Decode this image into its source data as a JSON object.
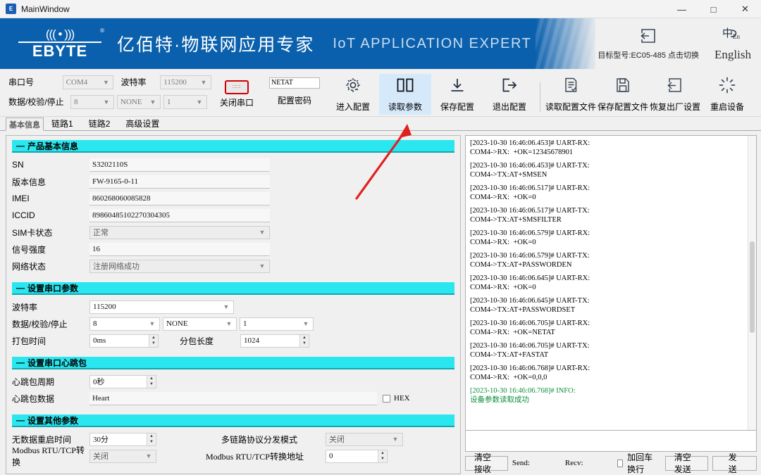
{
  "window": {
    "title": "MainWindow",
    "icon": "app-icon",
    "minimize": "—",
    "maximize": "□",
    "close": "✕"
  },
  "banner": {
    "logo_antenna": "((( • )))",
    "logo_name": "EBYTE",
    "logo_reg": "®",
    "slogan_cn": "亿佰特·物联网应用专家",
    "slogan_en": "IoT APPLICATION EXPERT",
    "brand_color": "#0b60ad",
    "model_switch": {
      "icon": "switch-model-icon",
      "label": "目标型号:EC05-485 点击切换"
    },
    "language": {
      "icon": "language-icon",
      "label": "English"
    }
  },
  "toolbar": {
    "serial": {
      "port_label": "串口号",
      "port_value": "COM4",
      "baud_label": "波特率",
      "baud_value": "115200",
      "dps_label": "数据/校验/停止",
      "data_value": "8",
      "parity_value": "NONE",
      "stop_value": "1",
      "close_port_label": "关闭串口",
      "db9_icon": "serial-port-icon"
    },
    "password": {
      "value": "NETAT",
      "label": "配置密码"
    },
    "buttons": [
      {
        "icon": "gear-icon",
        "label": "进入配置",
        "active": false
      },
      {
        "icon": "book-icon",
        "label": "读取参数",
        "active": true
      },
      {
        "icon": "download-icon",
        "label": "保存配置",
        "active": false
      },
      {
        "icon": "exit-icon",
        "label": "退出配置",
        "active": false
      },
      {
        "icon": "file-read-icon",
        "label": "读取配置文件",
        "active": false
      },
      {
        "icon": "file-save-icon",
        "label": "保存配置文件",
        "active": false
      },
      {
        "icon": "factory-reset-icon",
        "label": "恢复出厂设置",
        "active": false
      },
      {
        "icon": "restart-icon",
        "label": "重启设备",
        "active": false
      }
    ]
  },
  "tabs": [
    {
      "label": "基本信息",
      "selected": true
    },
    {
      "label": "链路1",
      "selected": false
    },
    {
      "label": "链路2",
      "selected": false
    },
    {
      "label": "高级设置",
      "selected": false
    }
  ],
  "sections": {
    "product": {
      "title": "产品基本信息",
      "rows": [
        {
          "label": "SN",
          "value": "S3202110S",
          "type": "input"
        },
        {
          "label": "版本信息",
          "value": "FW-9165-0-11",
          "type": "input"
        },
        {
          "label": "IMEI",
          "value": "860268060085828",
          "type": "input"
        },
        {
          "label": "ICCID",
          "value": "89860485102270304305",
          "type": "input"
        },
        {
          "label": "SIM卡状态",
          "value": "正常",
          "type": "select"
        },
        {
          "label": "信号强度",
          "value": "16",
          "type": "input"
        },
        {
          "label": "网络状态",
          "value": "注册网络成功",
          "type": "select"
        }
      ]
    },
    "serial_params": {
      "title": "设置串口参数",
      "baud_label": "波特率",
      "baud_value": "115200",
      "dps_label": "数据/校验/停止",
      "data_value": "8",
      "parity_value": "NONE",
      "stop_value": "1",
      "pack_time_label": "打包时间",
      "pack_time_value": "0ms",
      "pack_len_label": "分包长度",
      "pack_len_value": "1024"
    },
    "heartbeat": {
      "title": "设置串口心跳包",
      "period_label": "心跳包周期",
      "period_value": "0秒",
      "data_label": "心跳包数据",
      "data_value": "Heart",
      "hex_label": "HEX",
      "hex_checked": false
    },
    "other": {
      "title": "设置其他参数",
      "nodata_label": "无数据重启时间",
      "nodata_value": "30分",
      "multilink_label": "多链路协议分发模式",
      "multilink_value": "关闭",
      "modbus_label": "Modbus RTU/TCP转换",
      "modbus_value": "关闭",
      "modbus_addr_label": "Modbus RTU/TCP转换地址",
      "modbus_addr_value": "0"
    }
  },
  "log": {
    "entries": [
      {
        "head": "[2023-10-30 16:46:06.453]# UART-RX:",
        "body": "COM4->RX:  +OK=12345678901",
        "green": false
      },
      {
        "head": "[2023-10-30 16:46:06.453]# UART-TX:",
        "body": "COM4->TX:AT+SMSEN",
        "green": false
      },
      {
        "head": "[2023-10-30 16:46:06.517]# UART-RX:",
        "body": "COM4->RX:  +OK=0",
        "green": false
      },
      {
        "head": "[2023-10-30 16:46:06.517]# UART-TX:",
        "body": "COM4->TX:AT+SMSFILTER",
        "green": false
      },
      {
        "head": "[2023-10-30 16:46:06.579]# UART-RX:",
        "body": "COM4->RX:  +OK=0",
        "green": false
      },
      {
        "head": "[2023-10-30 16:46:06.579]# UART-TX:",
        "body": "COM4->TX:AT+PASSWORDEN",
        "green": false
      },
      {
        "head": "[2023-10-30 16:46:06.645]# UART-RX:",
        "body": "COM4->RX:  +OK=0",
        "green": false
      },
      {
        "head": "[2023-10-30 16:46:06.645]# UART-TX:",
        "body": "COM4->TX:AT+PASSWORDSET",
        "green": false
      },
      {
        "head": "[2023-10-30 16:46:06.705]# UART-RX:",
        "body": "COM4->RX:  +OK=NETAT",
        "green": false
      },
      {
        "head": "[2023-10-30 16:46:06.705]# UART-TX:",
        "body": "COM4->TX:AT+FASTAT",
        "green": false
      },
      {
        "head": "[2023-10-30 16:46:06.768]# UART-RX:",
        "body": "COM4->RX:  +OK=0,0,0",
        "green": false
      },
      {
        "head": "[2023-10-30 16:46:06.768]# INFO:",
        "body": "设备参数读取成功",
        "green": true
      }
    ],
    "send_value": ""
  },
  "footer": {
    "clear_recv": "清空接收",
    "send_stat": "Send:",
    "recv_stat": "Recv:",
    "crlf_label": "加回车换行",
    "crlf_checked": false,
    "clear_send": "清空发送",
    "send": "发送"
  },
  "annotation": {
    "arrow": "red-arrow",
    "color": "#e02020"
  }
}
